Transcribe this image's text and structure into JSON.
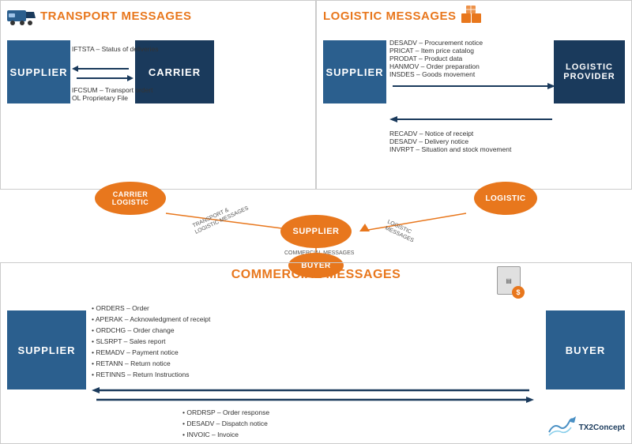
{
  "transport": {
    "title": "TRANSPORT MESSAGES",
    "supplier_label": "SUPPLIER",
    "carrier_label": "CARRIER",
    "upper_messages": [
      "IFTSTA – Status of deliveries"
    ],
    "lower_messages": [
      "IFCSUM – Transport ordert",
      "OL Proprietary File"
    ]
  },
  "logistic": {
    "title": "LOGISTIC MESSAGES",
    "supplier_label": "SUPPLIER",
    "provider_label": "LOGISTIC PROVIDER",
    "upper_messages": [
      "DESADV – Procurement notice",
      "PRICAT – Item price catalog",
      "PRODAT – Product data",
      "HANMOV – Order preparation",
      "INSDES – Goods movement"
    ],
    "lower_messages": [
      "RECADV – Notice of receipt",
      "DESADV – Delivery notice",
      "INVRPT – Situation and stock movement"
    ]
  },
  "middle": {
    "carrier_logistic_label": "CARRIER LOGISTIC",
    "logistic_label": "LOGISTIC",
    "supplier_label": "SUPPLIER",
    "buyer_label": "BUYER",
    "transport_logistic_msg": "TRANSPORT & LOGISTIC MESSAGES",
    "logistic_msg": "LOGISTIC MESSAGES",
    "commercial_msg": "COMMERCIAL MESSAGES"
  },
  "commercial": {
    "title": "COMMERCIAL MESSAGES",
    "supplier_label": "SUPPLIER",
    "buyer_label": "BUYER",
    "upper_messages": [
      "ORDERS – Order",
      "APERAK – Acknowledgment of receipt",
      "ORDCHG – Order change",
      "SLSRPT – Sales report",
      "REMADV – Payment notice",
      "RETANN – Return notice",
      "RETINNS – Return Instructions"
    ],
    "lower_messages": [
      "ORDRSP – Order response",
      "DESADV – Dispatch notice",
      "INVOIC – Invoice"
    ]
  },
  "brand": {
    "name": "TX2Concept"
  },
  "colors": {
    "orange": "#e8771d",
    "dark_blue": "#1a3a5c",
    "mid_blue": "#2b5f8e",
    "light_blue": "#4a7fad"
  }
}
